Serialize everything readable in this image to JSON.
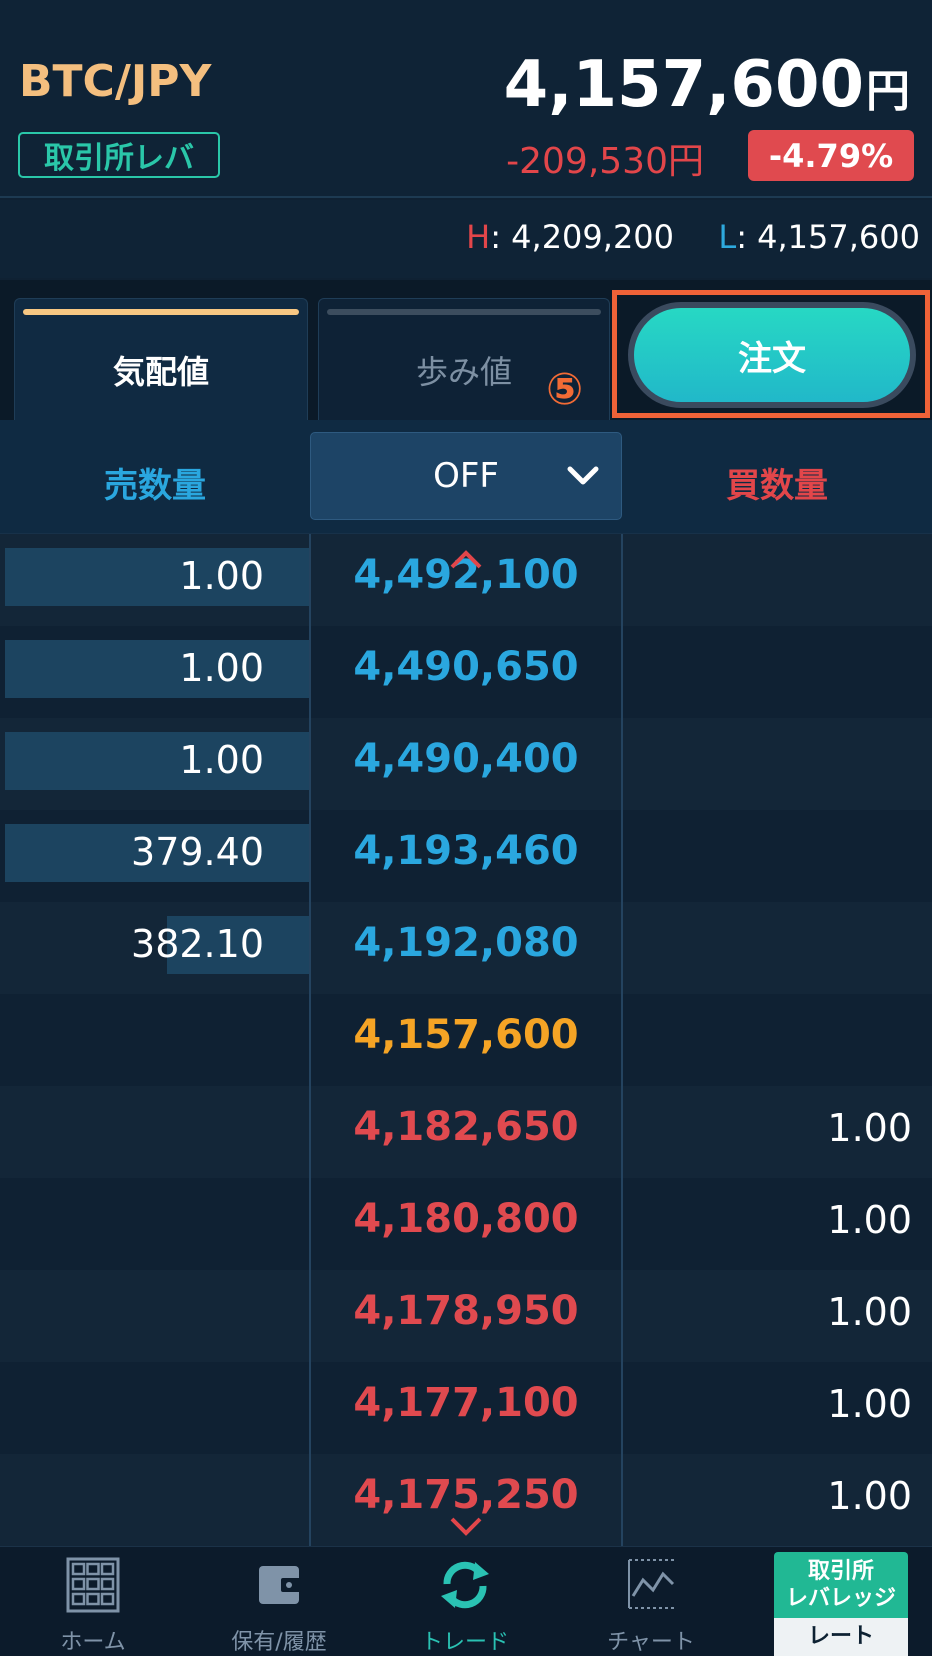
{
  "header": {
    "pair": "BTC/JPY",
    "market_badge": "取引所レバ",
    "price": "4,157,600",
    "price_unit": "円",
    "change": "-209,530円",
    "change_pct": "-4.79%"
  },
  "high_low": {
    "high_label": "H",
    "high_value": ": 4,209,200",
    "low_label": "L",
    "low_value": ": 4,157,600"
  },
  "tabs": {
    "quotes": "気配値",
    "trades": "歩み値",
    "step_marker": "⑤",
    "order_button": "注文"
  },
  "book_header": {
    "sell_qty": "売数量",
    "grouping": "OFF",
    "buy_qty": "買数量"
  },
  "order_book": {
    "asks": [
      {
        "qty": "1.00",
        "price": "4,492,100",
        "depth": 1.0
      },
      {
        "qty": "1.00",
        "price": "4,490,650",
        "depth": 1.0
      },
      {
        "qty": "1.00",
        "price": "4,490,400",
        "depth": 1.0
      },
      {
        "qty": "379.40",
        "price": "4,193,460",
        "depth": 1.0
      },
      {
        "qty": "382.10",
        "price": "4,192,080",
        "depth": 0.47
      }
    ],
    "last_price": "4,157,600",
    "bids": [
      {
        "price": "4,182,650",
        "qty": "1.00"
      },
      {
        "price": "4,180,800",
        "qty": "1.00"
      },
      {
        "price": "4,178,950",
        "qty": "1.00"
      },
      {
        "price": "4,177,100",
        "qty": "1.00"
      },
      {
        "price": "4,175,250",
        "qty": "1.00"
      }
    ]
  },
  "bottom_nav": {
    "home": "ホーム",
    "holdings": "保有/履歴",
    "trade": "トレード",
    "chart": "チャート",
    "rate_badge_line1": "取引所",
    "rate_badge_line2": "レバレッジ",
    "rate_badge_line3": "レート"
  },
  "colors": {
    "ask": "#2aa7df",
    "bid": "#e04a4f",
    "last": "#f5a425",
    "accent": "#2ac7a9",
    "highlight": "#ef6238"
  }
}
